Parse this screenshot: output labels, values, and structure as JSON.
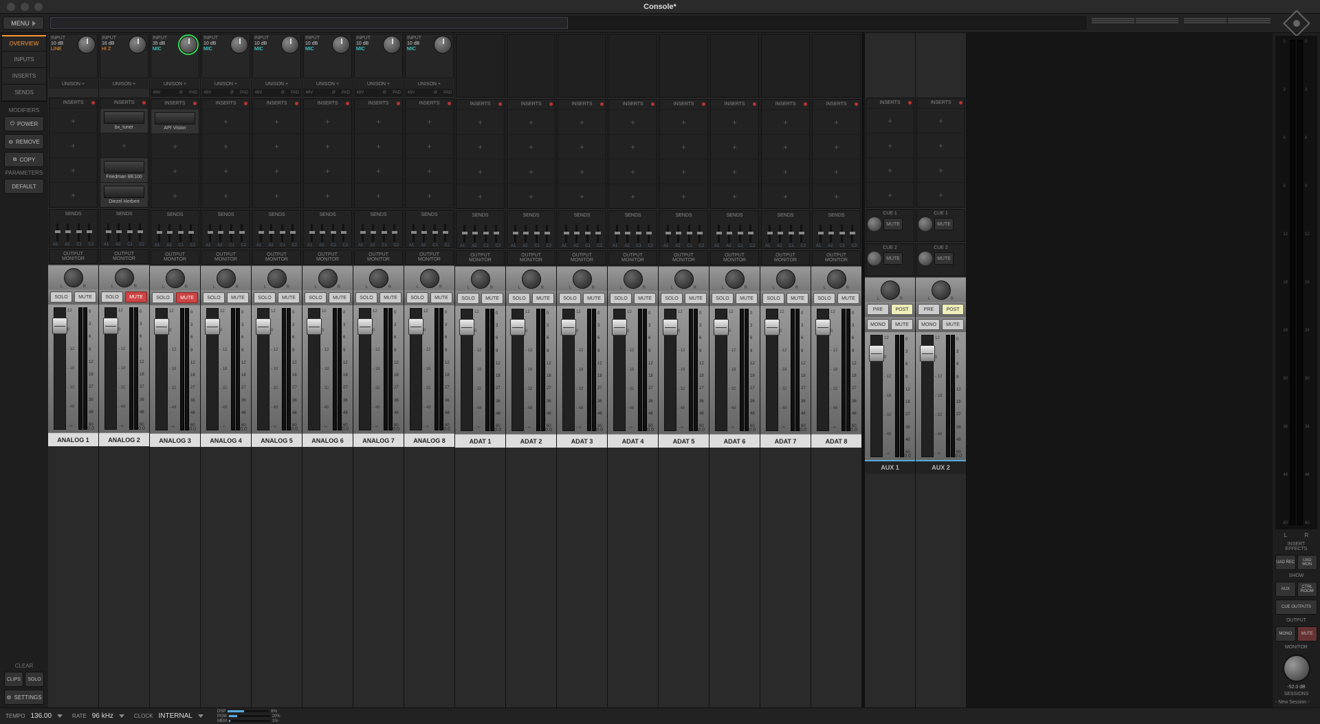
{
  "title": "Console*",
  "menu": {
    "label": "MENU"
  },
  "sidebar": {
    "tabs": [
      "OVERVIEW",
      "INPUTS",
      "INSERTS",
      "SENDS"
    ],
    "modifiers_title": "MODIFIERS",
    "power": "POWER",
    "remove": "REMOVE",
    "copy": "COPY",
    "parameters_title": "PARAMETERS",
    "default": "DEFAULT",
    "clear_title": "CLEAR",
    "clips": "CLIPS",
    "solo": "SOLO",
    "settings": "SETTINGS"
  },
  "labels": {
    "input": "INPUT",
    "unison": "UNISON +",
    "inserts": "INSERTS",
    "sends": "SENDS",
    "output": "OUTPUT",
    "monitor": "MONITOR",
    "solo": "SOLO",
    "mute": "MUTE",
    "mono": "MONO",
    "pre": "PRE",
    "post": "POST",
    "cue1": "CUE 1",
    "cue2": "CUE 2",
    "flags": [
      "48V",
      "",
      "Ø",
      "PAD"
    ],
    "send_cols": [
      "A1",
      "A2",
      "C1",
      "C2"
    ],
    "fader_scale": [
      "12",
      "0",
      "- 12",
      "- 18",
      "- 32",
      "- 48",
      "- ∞"
    ],
    "meter_scale": [
      "0",
      "3",
      "6",
      "9",
      "12",
      "18",
      "27",
      "36",
      "48",
      "60"
    ],
    "pan_l": "L",
    "pan_r": "R"
  },
  "channels": [
    {
      "name": "ANALOG 1",
      "gain": "10 dB",
      "type": "LINE",
      "type_cls": "line",
      "has_input": true,
      "has_micflags": false,
      "mute": false,
      "inserts": [
        "",
        "",
        "",
        ""
      ],
      "knob_cls": ""
    },
    {
      "name": "ANALOG 2",
      "gain": "16 dB",
      "type": "HI Z",
      "type_cls": "hiz",
      "has_input": true,
      "has_micflags": false,
      "mute": true,
      "inserts": [
        "bx_tuner",
        "",
        "Friedman BE100",
        "Diezel Herbert"
      ],
      "knob_cls": ""
    },
    {
      "name": "ANALOG 3",
      "gain": "35 dB",
      "type": "MIC",
      "type_cls": "mic",
      "has_input": true,
      "has_micflags": true,
      "mute": true,
      "inserts": [
        "API Vision",
        "",
        "",
        ""
      ],
      "knob_cls": "green"
    },
    {
      "name": "ANALOG 4",
      "gain": "10 dB",
      "type": "MIC",
      "type_cls": "mic",
      "has_input": true,
      "has_micflags": true,
      "mute": false,
      "inserts": [
        "",
        "",
        "",
        ""
      ],
      "knob_cls": ""
    },
    {
      "name": "ANALOG 5",
      "gain": "10 dB",
      "type": "MIC",
      "type_cls": "mic",
      "has_input": true,
      "has_micflags": true,
      "mute": false,
      "inserts": [
        "",
        "",
        "",
        ""
      ],
      "knob_cls": ""
    },
    {
      "name": "ANALOG 6",
      "gain": "10 dB",
      "type": "MIC",
      "type_cls": "mic",
      "has_input": true,
      "has_micflags": true,
      "mute": false,
      "inserts": [
        "",
        "",
        "",
        ""
      ],
      "knob_cls": ""
    },
    {
      "name": "ANALOG 7",
      "gain": "10 dB",
      "type": "MIC",
      "type_cls": "mic",
      "has_input": true,
      "has_micflags": true,
      "mute": false,
      "inserts": [
        "",
        "",
        "",
        ""
      ],
      "knob_cls": ""
    },
    {
      "name": "ANALOG 8",
      "gain": "10 dB",
      "type": "MIC",
      "type_cls": "mic",
      "has_input": true,
      "has_micflags": true,
      "mute": false,
      "inserts": [
        "",
        "",
        "",
        ""
      ],
      "knob_cls": ""
    },
    {
      "name": "ADAT 1",
      "has_input": false,
      "mute": false,
      "inserts": [
        "",
        "",
        "",
        ""
      ]
    },
    {
      "name": "ADAT 2",
      "has_input": false,
      "mute": false,
      "inserts": [
        "",
        "",
        "",
        ""
      ]
    },
    {
      "name": "ADAT 3",
      "has_input": false,
      "mute": false,
      "inserts": [
        "",
        "",
        "",
        ""
      ]
    },
    {
      "name": "ADAT 4",
      "has_input": false,
      "mute": false,
      "inserts": [
        "",
        "",
        "",
        ""
      ]
    },
    {
      "name": "ADAT 5",
      "has_input": false,
      "mute": false,
      "inserts": [
        "",
        "",
        "",
        ""
      ]
    },
    {
      "name": "ADAT 6",
      "has_input": false,
      "mute": false,
      "inserts": [
        "",
        "",
        "",
        ""
      ]
    },
    {
      "name": "ADAT 7",
      "has_input": false,
      "mute": false,
      "inserts": [
        "",
        "",
        "",
        ""
      ]
    },
    {
      "name": "ADAT 8",
      "has_input": false,
      "mute": false,
      "inserts": [
        "",
        "",
        "",
        ""
      ]
    }
  ],
  "aux_channels": [
    {
      "name": "AUX 1"
    },
    {
      "name": "AUX 2"
    }
  ],
  "fader_value": "0.0",
  "right": {
    "insert_effects": "INSERT EFFECTS",
    "uad_rec": "UAD REC",
    "uad_mon": "UAD MON",
    "show": "SHOW",
    "aux": "AUX",
    "ctrl_room": "CTRL ROOM",
    "cue_outputs": "CUE OUTPUTS",
    "output": "OUTPUT",
    "mono": "MONO",
    "mute": "MUTE",
    "monitor": "MONITOR",
    "mon_val": "-52.0 dB",
    "sessions": "SESSIONS",
    "session_name": "- New Session -",
    "meter_scale": [
      "0",
      "3",
      "6",
      "9",
      "12",
      "18",
      "24",
      "30",
      "36",
      "48",
      "60"
    ],
    "L": "L",
    "R": "R"
  },
  "status": {
    "tempo_label": "TEMPO",
    "tempo": "136.00",
    "rate_label": "RATE",
    "rate": "96 kHz",
    "clock_label": "CLOCK",
    "clock": "INTERNAL",
    "dsp": [
      {
        "label": "DSP",
        "pct": "6%",
        "fill": 40
      },
      {
        "label": "PGM",
        "pct": "20%",
        "fill": 20
      },
      {
        "label": "MEM",
        "pct": "1%",
        "fill": 4
      }
    ]
  }
}
